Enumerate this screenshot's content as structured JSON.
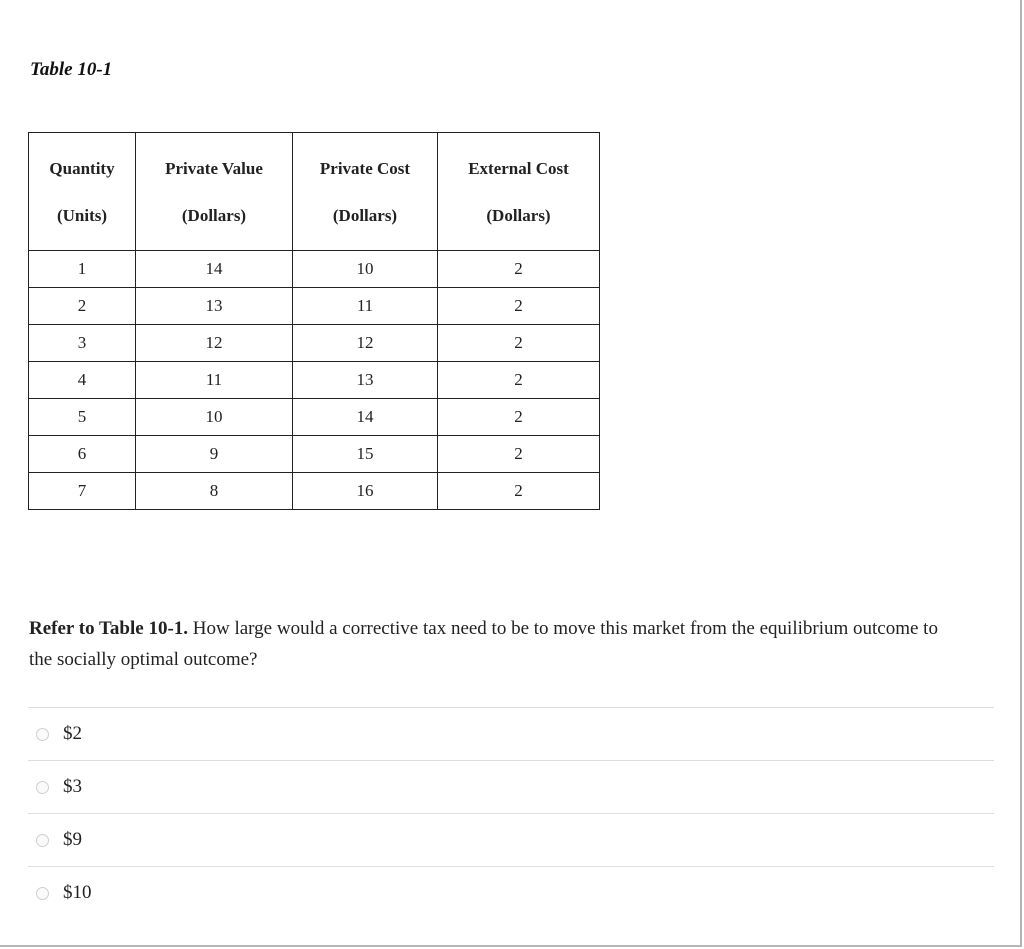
{
  "table_title": "Table 10-1",
  "table": {
    "headers": [
      {
        "line1": "Quantity",
        "line2": "(Units)"
      },
      {
        "line1": "Private Value",
        "line2": "(Dollars)"
      },
      {
        "line1": "Private Cost",
        "line2": "(Dollars)"
      },
      {
        "line1": "External Cost",
        "line2": "(Dollars)"
      }
    ],
    "rows": [
      [
        "1",
        "14",
        "10",
        "2"
      ],
      [
        "2",
        "13",
        "11",
        "2"
      ],
      [
        "3",
        "12",
        "12",
        "2"
      ],
      [
        "4",
        "11",
        "13",
        "2"
      ],
      [
        "5",
        "10",
        "14",
        "2"
      ],
      [
        "6",
        "9",
        "15",
        "2"
      ],
      [
        "7",
        "8",
        "16",
        "2"
      ]
    ]
  },
  "question": {
    "bold_prefix": "Refer to Table 10-1.",
    "text": " How large would a corrective tax need to be to move this market from the equilibrium outcome to the socially optimal outcome?"
  },
  "options": [
    {
      "label": "$2",
      "selected": false
    },
    {
      "label": "$3",
      "selected": false
    },
    {
      "label": "$9",
      "selected": false
    },
    {
      "label": "$10",
      "selected": false
    }
  ]
}
